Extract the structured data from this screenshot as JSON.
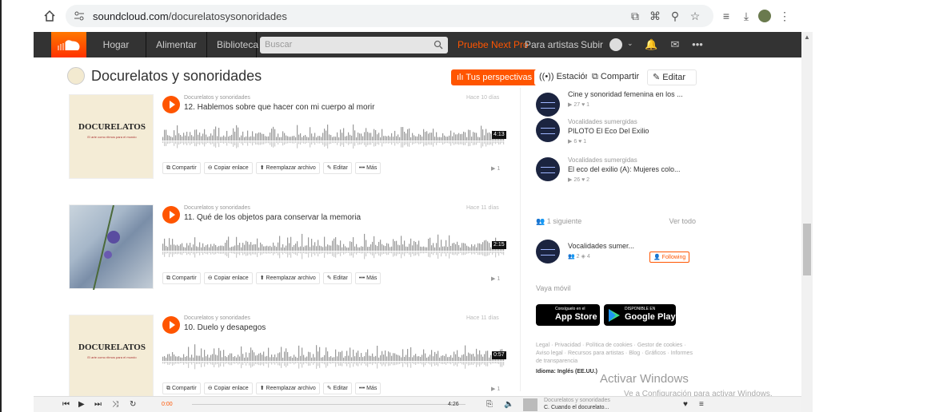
{
  "browser": {
    "url_domain": "soundcloud.com",
    "url_path": "/docurelatosysonoridades"
  },
  "header": {
    "nav": [
      "Hogar",
      "Alimentar",
      "Biblioteca"
    ],
    "search_placeholder": "Buscar",
    "pro": "Pruebe Next Pro",
    "artists": "Para artistas",
    "upload": "Subir"
  },
  "profile": {
    "title": "Docurelatos y sonoridades",
    "insights": "Tus perspectivas",
    "station": "Estación",
    "share": "Compartir",
    "edit": "Editar"
  },
  "tracks": [
    {
      "user": "Docurelatos y sonoridades",
      "title": "12. Hablemos sobre que hacer con mi cuerpo al morir",
      "date": "Hace 10 días",
      "duration": "4:13",
      "plays": "1",
      "cover_title": "DOCURELATOS",
      "cover_sub": "El arte como ritmos para el mundo"
    },
    {
      "user": "Docurelatos y sonoridades",
      "title": "11. Qué de los objetos para conservar la memoria",
      "date": "Hace 11 días",
      "duration": "2:15",
      "plays": "1",
      "cover_title": "",
      "cover_sub": ""
    },
    {
      "user": "Docurelatos y sonoridades",
      "title": "10. Duelo y desapegos",
      "date": "Hace 11 días",
      "duration": "0:57",
      "plays": "1",
      "cover_title": "DOCURELATOS",
      "cover_sub": "El arte como ritmos para el mundo"
    }
  ],
  "track_actions": [
    "Compartir",
    "Copiar enlace",
    "Reemplazar archivo",
    "Editar",
    "Más"
  ],
  "related": [
    {
      "user": "",
      "title": "Cine y sonoridad femenina en los ...",
      "plays": "27",
      "likes": "1"
    },
    {
      "user": "Vocalidades sumergidas",
      "title": "PILOTO El Eco Del Exilio",
      "plays": "6",
      "likes": "1"
    },
    {
      "user": "Vocalidades sumergidas",
      "title": "El eco del exilio (A): Mujeres colo...",
      "plays": "26",
      "likes": "2"
    }
  ],
  "following": {
    "header": "1 siguiente",
    "view_all": "Ver todo",
    "name": "Vocalidades sumer...",
    "followers": "2",
    "tracks": "4",
    "button": "Following"
  },
  "mobile": {
    "label": "Vaya móvil",
    "appstore_small": "Consíguelo en el",
    "appstore": "App Store",
    "gplay_small": "DISPONIBLE EN",
    "gplay": "Google Play"
  },
  "legal": "Legal · Privacidad · Política de cookies · Gestor de cookies · Aviso legal · Recursos para artistas · Blog · Gráficos · Informes de transparencia",
  "language_label": "Idioma:",
  "language": "Inglés (EE.UU.)",
  "windows": {
    "line1": "Activar Windows",
    "line2": "Ve a Configuración para activar Windows."
  },
  "player": {
    "current": "0:00",
    "total": "4:26",
    "artist": "Docurelatos y sonoridades",
    "title": "C. Cuando el docurelato..."
  }
}
